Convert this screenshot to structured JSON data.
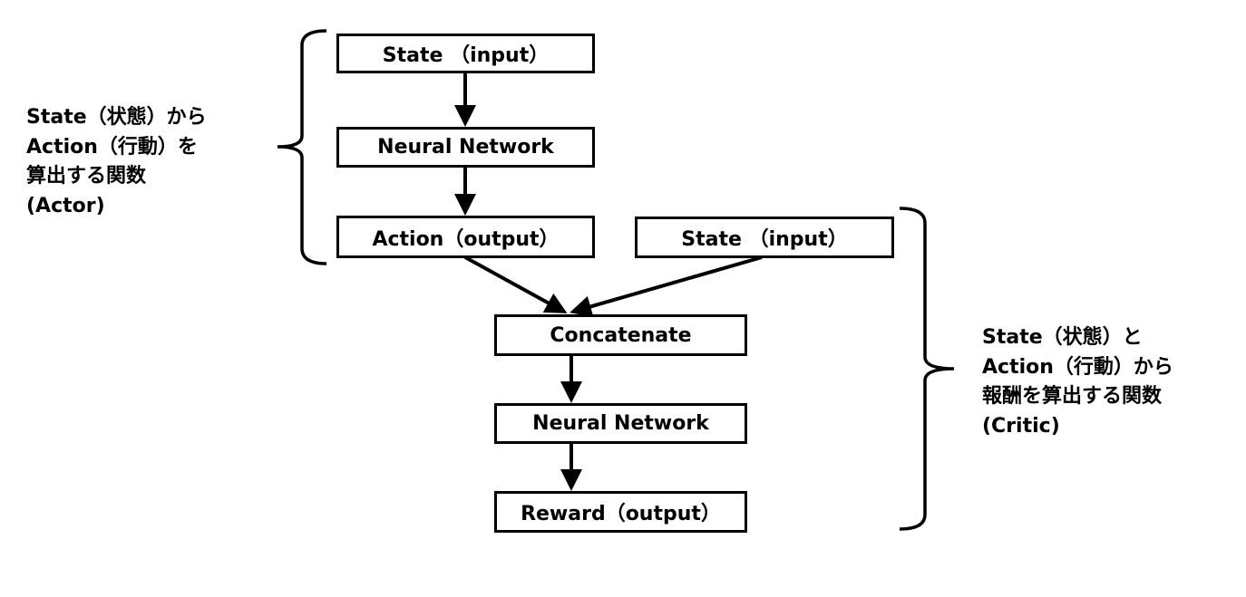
{
  "actor": {
    "nodes": [
      "State （input）",
      "Neural Network",
      "Action（output）"
    ],
    "description_lines": [
      "State（状態）から",
      "Action（行動）を",
      "算出する関数",
      "(Actor)"
    ]
  },
  "critic": {
    "nodes": [
      "State （input）",
      "Concatenate",
      "Neural Network",
      "Reward（output）"
    ],
    "description_lines": [
      "State（状態）と",
      "Action（行動）から",
      "報酬を算出する関数",
      "(Critic)"
    ]
  }
}
